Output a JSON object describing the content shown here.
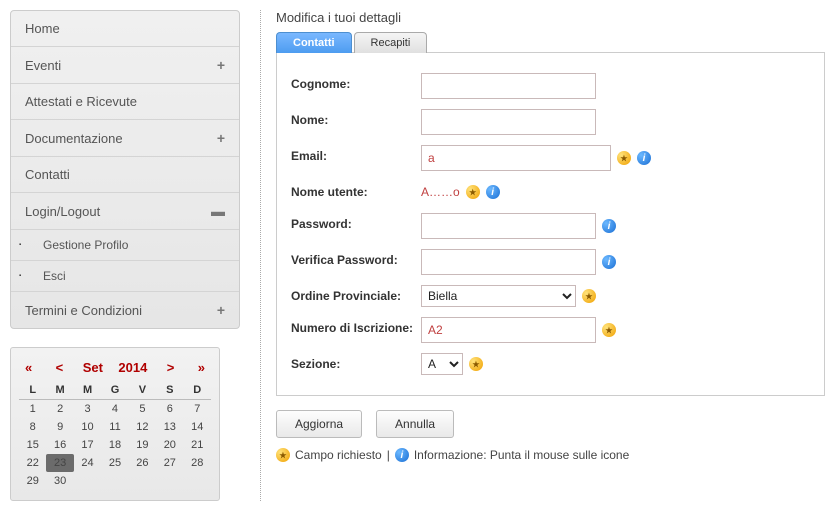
{
  "sidebar": {
    "items": [
      {
        "label": "Home",
        "expand": null
      },
      {
        "label": "Eventi",
        "expand": "plus"
      },
      {
        "label": "Attestati e Ricevute",
        "expand": null
      },
      {
        "label": "Documentazione",
        "expand": "plus"
      },
      {
        "label": "Contatti",
        "expand": null
      },
      {
        "label": "Login/Logout",
        "expand": "minus"
      }
    ],
    "subitems": [
      {
        "label": "Gestione Profilo"
      },
      {
        "label": "Esci"
      }
    ],
    "last": {
      "label": "Termini e Condizioni",
      "expand": "plus"
    }
  },
  "calendar": {
    "prev_all": "«",
    "prev": "<",
    "month": "Set",
    "year": "2014",
    "next": ">",
    "next_all": "»",
    "dow": [
      "L",
      "M",
      "M",
      "G",
      "V",
      "S",
      "D"
    ],
    "weeks": [
      [
        {
          "d": "1"
        },
        {
          "d": "2"
        },
        {
          "d": "3"
        },
        {
          "d": "4"
        },
        {
          "d": "5"
        },
        {
          "d": "6"
        },
        {
          "d": "7"
        }
      ],
      [
        {
          "d": "8"
        },
        {
          "d": "9"
        },
        {
          "d": "10"
        },
        {
          "d": "11"
        },
        {
          "d": "12"
        },
        {
          "d": "13"
        },
        {
          "d": "14"
        }
      ],
      [
        {
          "d": "15"
        },
        {
          "d": "16",
          "red": true
        },
        {
          "d": "17"
        },
        {
          "d": "18"
        },
        {
          "d": "19"
        },
        {
          "d": "20"
        },
        {
          "d": "21"
        }
      ],
      [
        {
          "d": "22"
        },
        {
          "d": "23",
          "today": true
        },
        {
          "d": "24"
        },
        {
          "d": "25"
        },
        {
          "d": "26"
        },
        {
          "d": "27"
        },
        {
          "d": "28"
        }
      ],
      [
        {
          "d": "29"
        },
        {
          "d": "30"
        },
        {
          "d": ""
        },
        {
          "d": ""
        },
        {
          "d": ""
        },
        {
          "d": ""
        },
        {
          "d": ""
        }
      ]
    ]
  },
  "page": {
    "title": "Modifica i tuoi dettagli",
    "tabs": {
      "contatti": "Contatti",
      "recapiti": "Recapiti"
    }
  },
  "form": {
    "cognome": {
      "label": "Cognome:",
      "value": ""
    },
    "nome": {
      "label": "Nome:",
      "value": ""
    },
    "email": {
      "label": "Email:",
      "value": "a"
    },
    "nome_utente": {
      "label": "Nome utente:",
      "value": "A……o"
    },
    "password": {
      "label": "Password:",
      "value": ""
    },
    "verifica_password": {
      "label": "Verifica Password:",
      "value": ""
    },
    "ordine": {
      "label": "Ordine Provinciale:",
      "selected": "Biella"
    },
    "numero_iscrizione": {
      "label": "Numero di Iscrizione:",
      "value": "A2"
    },
    "sezione": {
      "label": "Sezione:",
      "selected": "A"
    }
  },
  "buttons": {
    "aggiorna": "Aggiorna",
    "annulla": "Annulla"
  },
  "legend": {
    "required": "Campo richiesto",
    "sep": " | ",
    "info": "Informazione: Punta il mouse sulle icone"
  }
}
